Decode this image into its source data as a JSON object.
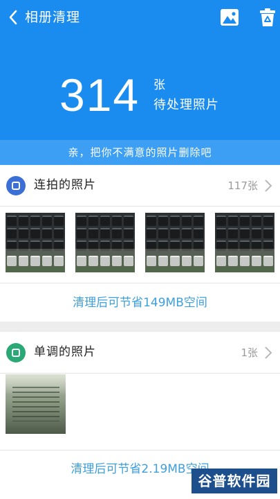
{
  "header": {
    "title": "相册清理",
    "count": "314",
    "unit": "张",
    "pending": "待处理照片"
  },
  "hint": "亲，把你不满意的照片删除吧",
  "sections": [
    {
      "title": "连拍的照片",
      "count": "117张",
      "savings": "清理后可节省149MB空间",
      "accent": "#3b6fd6"
    },
    {
      "title": "单调的照片",
      "count": "1张",
      "savings": "清理后可节省2.19MB空间",
      "accent": "#2aa876"
    }
  ],
  "icons": {
    "back": "chevron-left-icon",
    "gallery": "image-icon",
    "recycle": "recycle-bin-icon",
    "arrow": "chevron-right-icon"
  },
  "colors": {
    "primary": "#1a8cf0",
    "link": "#3d9fdc"
  },
  "watermark": "谷普软件园"
}
